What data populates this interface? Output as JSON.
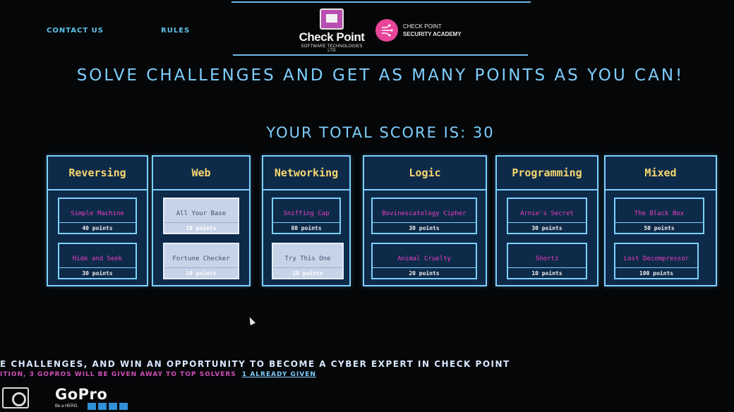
{
  "nav": {
    "contact": "CONTACT US",
    "rules": "RULES"
  },
  "logos": {
    "checkpoint_name": "Check Point",
    "checkpoint_sub": "SOFTWARE TECHNOLOGIES LTD",
    "academy_line1": "CHECK POINT",
    "academy_line2": "SECURITY ACADEMY"
  },
  "headline": "SOLVE CHALLENGES AND GET AS MANY POINTS AS YOU CAN!",
  "score_text": "YOUR TOTAL SCORE IS: 30",
  "categories": [
    {
      "title": "Reversing",
      "challenges": [
        {
          "name": "Simple Machine",
          "points": "40 points",
          "solved": false
        },
        {
          "name": "Hide and Seek",
          "points": "30 points",
          "solved": false
        }
      ]
    },
    {
      "title": "Web",
      "challenges": [
        {
          "name": "All Your Base",
          "points": "10 points",
          "solved": true
        },
        {
          "name": "Fortune Checker",
          "points": "10 points",
          "solved": true
        }
      ]
    },
    {
      "title": "Networking",
      "challenges": [
        {
          "name": "Sniffing Cap",
          "points": "80 points",
          "solved": false
        },
        {
          "name": "Try This One",
          "points": "20 points",
          "solved": true
        }
      ]
    },
    {
      "title": "Logic",
      "challenges": [
        {
          "name": "Bovinescatology Cipher",
          "points": "30 points",
          "solved": false
        },
        {
          "name": "Animal Cruelty",
          "points": "20 points",
          "solved": false
        }
      ]
    },
    {
      "title": "Programming",
      "challenges": [
        {
          "name": "Arnie's Secret",
          "points": "30 points",
          "solved": false
        },
        {
          "name": "Shortz",
          "points": "10 points",
          "solved": false
        }
      ]
    },
    {
      "title": "Mixed",
      "challenges": [
        {
          "name": "The Black Box",
          "points": "50 points",
          "solved": false
        },
        {
          "name": "Lost Decompressor",
          "points": "100 points",
          "solved": false
        }
      ]
    }
  ],
  "bottom": {
    "line1": "E CHALLENGES, AND WIN AN OPPORTUNITY TO BECOME A CYBER EXPERT IN CHECK POINT",
    "line2": "ITION, 3 GOPROS WILL BE GIVEN AWAY TO TOP SOLVERS",
    "given_link": "1 ALREADY GIVEN"
  },
  "gopro": {
    "word": "GoPro",
    "tagline": "Be a HERO."
  },
  "colors": {
    "background": "#050608",
    "accent_blue": "#7ecfff",
    "category_title": "#f6d770",
    "challenge_name": "#ef3ec0",
    "tile_fill": "#0e2a49",
    "solved_fill": "#c7d3e7"
  }
}
